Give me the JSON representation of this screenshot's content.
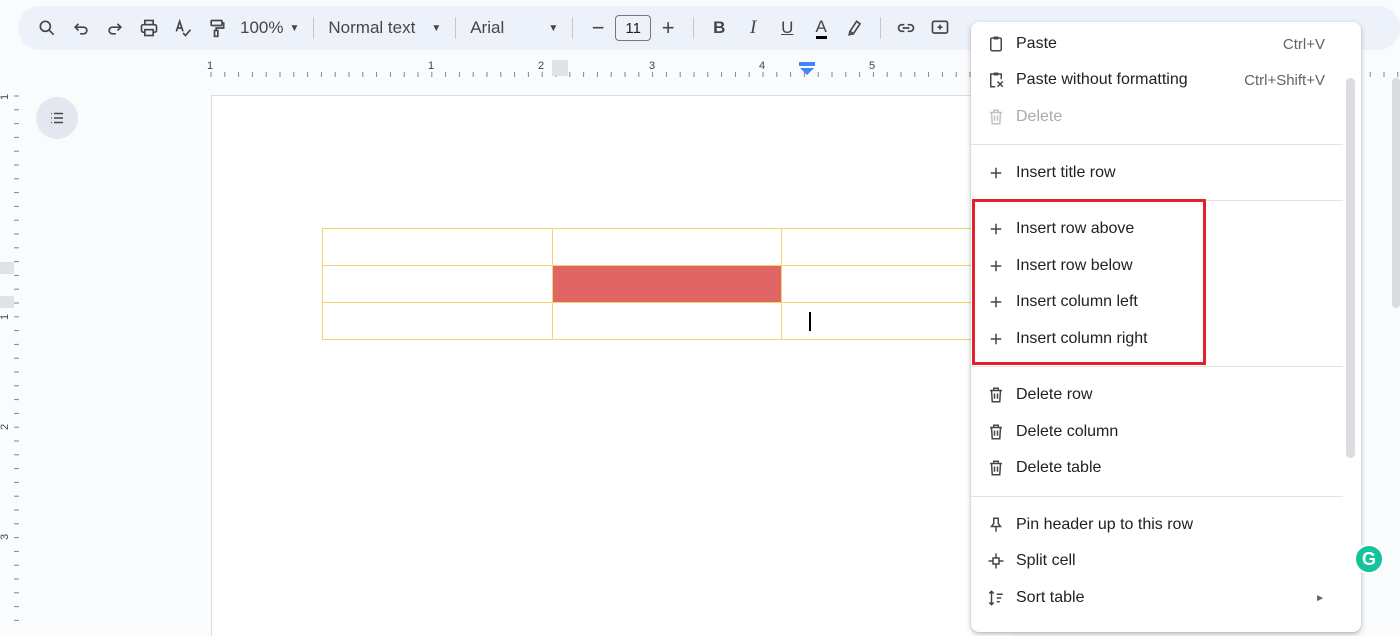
{
  "toolbar": {
    "zoom": "100%",
    "style": "Normal text",
    "font": "Arial",
    "font_size": "11"
  },
  "ruler": {
    "h_labels": [
      "1",
      "1",
      "2",
      "3",
      "4",
      "5"
    ],
    "v_labels": [
      "1",
      "1",
      "2",
      "3"
    ]
  },
  "context_menu": {
    "items": [
      {
        "label": "Paste",
        "shortcut": "Ctrl+V",
        "icon": "clipboard-icon"
      },
      {
        "label": "Paste without formatting",
        "shortcut": "Ctrl+Shift+V",
        "icon": "paste-plain-icon"
      },
      {
        "label": "Delete",
        "icon": "trash-icon",
        "disabled": true
      },
      {
        "label": "Insert title row",
        "icon": "plus-icon"
      },
      {
        "label": "Insert row above",
        "icon": "plus-icon"
      },
      {
        "label": "Insert row below",
        "icon": "plus-icon"
      },
      {
        "label": "Insert column left",
        "icon": "plus-icon"
      },
      {
        "label": "Insert column right",
        "icon": "plus-icon"
      },
      {
        "label": "Delete row",
        "icon": "trash-icon"
      },
      {
        "label": "Delete column",
        "icon": "trash-icon"
      },
      {
        "label": "Delete table",
        "icon": "trash-icon"
      },
      {
        "label": "Pin header up to this row",
        "icon": "pin-icon"
      },
      {
        "label": "Split cell",
        "icon": "split-cell-icon"
      },
      {
        "label": "Sort table",
        "icon": "sort-icon",
        "submenu": "►"
      }
    ]
  },
  "colors": {
    "highlight_cell": "#e06666",
    "table_border": "#f6d36b",
    "annotation_box": "#e2222a"
  },
  "badge": {
    "letter": "G"
  }
}
